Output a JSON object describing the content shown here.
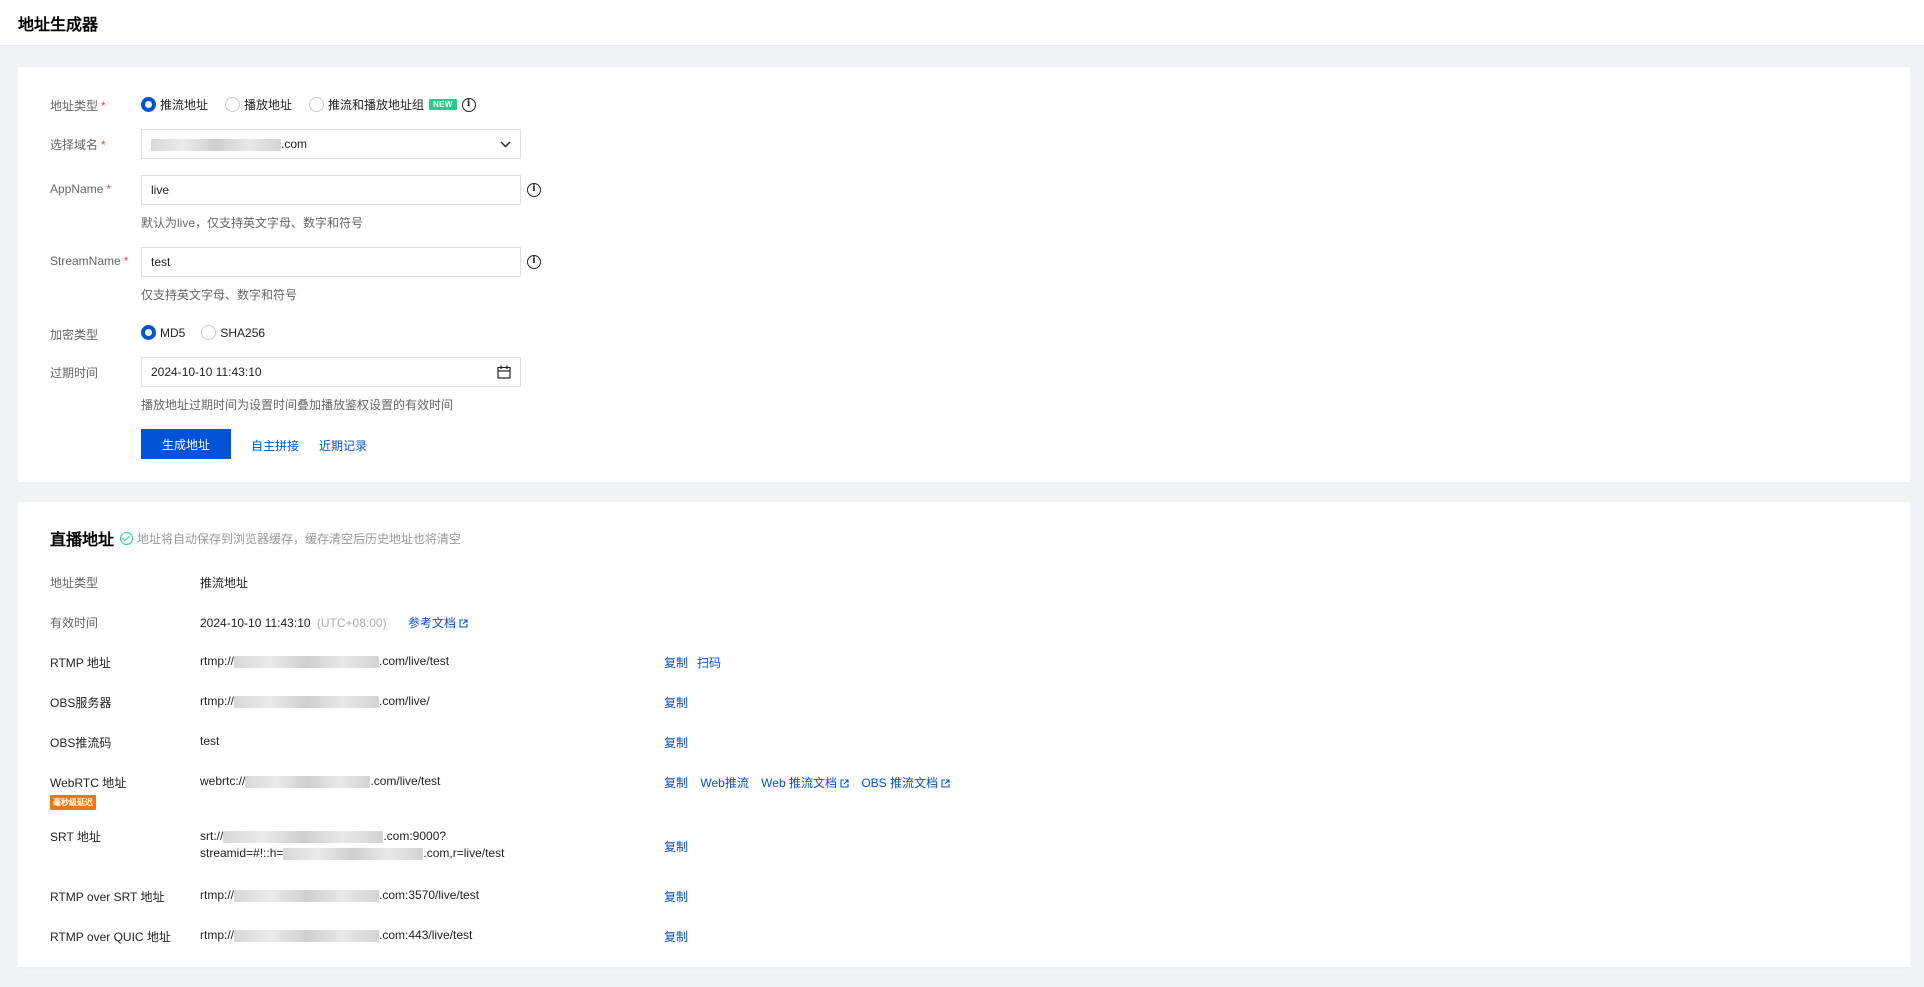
{
  "header": {
    "title": "地址生成器"
  },
  "form": {
    "address_type": {
      "label": "地址类型",
      "required": "*",
      "options": [
        "推流地址",
        "播放地址",
        "推流和播放地址组"
      ],
      "selected_index": 0,
      "new_badge": "NEW"
    },
    "domain": {
      "label": "选择域名",
      "required": "*",
      "value_suffix": ".com"
    },
    "app_name": {
      "label": "AppName",
      "required": "*",
      "value": "live",
      "hint": "默认为live，仅支持英文字母、数字和符号"
    },
    "stream_name": {
      "label": "StreamName",
      "required": "*",
      "value": "test",
      "hint": "仅支持英文字母、数字和符号"
    },
    "encrypt": {
      "label": "加密类型",
      "options": [
        "MD5",
        "SHA256"
      ],
      "selected_index": 0
    },
    "expire": {
      "label": "过期时间",
      "value": "2024-10-10 11:43:10",
      "hint": "播放地址过期时间为设置时间叠加播放鉴权设置的有效时间"
    },
    "actions": {
      "generate": "生成地址",
      "custom": "自主拼接",
      "history": "近期记录"
    }
  },
  "result": {
    "title": "直播地址",
    "note": "地址将自动保存到浏览器缓存，缓存清空后历史地址也将清空",
    "rows": {
      "type": {
        "label": "地址类型",
        "value": "推流地址"
      },
      "valid": {
        "label": "有效时间",
        "value": "2024-10-10 11:43:10",
        "tz": "(UTC+08:00)",
        "doc_link": "参考文档"
      },
      "rtmp": {
        "label": "RTMP 地址",
        "prefix": "rtmp://",
        "suffix": ".com/live/test",
        "copy": "复制",
        "scan": "扫码"
      },
      "obs_server": {
        "label": "OBS服务器",
        "prefix": "rtmp://",
        "suffix": ".com/live/",
        "copy": "复制"
      },
      "obs_key": {
        "label": "OBS推流码",
        "value": "test",
        "copy": "复制"
      },
      "webrtc": {
        "label": "WebRTC 地址",
        "badge": "毫秒级延迟",
        "prefix": "webrtc://",
        "suffix": ".com/live/test",
        "copy": "复制",
        "web_push": "Web推流",
        "web_doc": "Web 推流文档",
        "obs_doc": "OBS 推流文档"
      },
      "srt": {
        "label": "SRT 地址",
        "line1_prefix": "srt://",
        "line1_suffix": ".com:9000?",
        "line2_prefix": "streamid=#!::h=",
        "line2_suffix": ".com,r=live/test",
        "copy": "复制"
      },
      "rtmp_srt": {
        "label": "RTMP over SRT 地址",
        "prefix": "rtmp://",
        "suffix": ".com:3570/live/test",
        "copy": "复制"
      },
      "rtmp_quic": {
        "label": "RTMP over QUIC 地址",
        "prefix": "rtmp://",
        "suffix": ".com:443/live/test",
        "copy": "复制"
      }
    }
  }
}
